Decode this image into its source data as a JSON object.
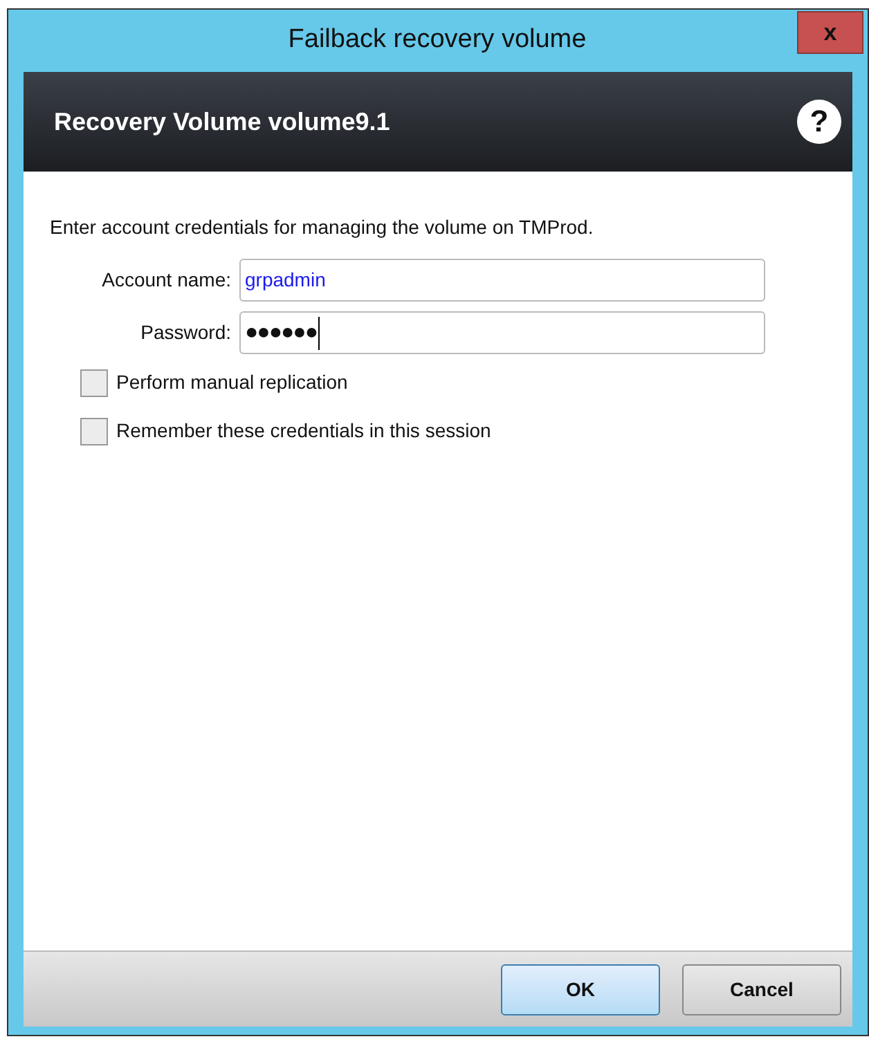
{
  "window": {
    "title": "Failback recovery volume",
    "close": "x"
  },
  "header": {
    "title": "Recovery Volume volume9.1",
    "help": "?"
  },
  "instructions": "Enter account credentials for managing the volume on TMProd.",
  "fields": [
    {
      "label": "Account name:",
      "value": "grpadmin",
      "kind": "text"
    },
    {
      "label": "Password:",
      "value": "●●●●●●",
      "kind": "password"
    }
  ],
  "options": [
    {
      "label": "Perform manual replication",
      "checked": false
    },
    {
      "label": "Remember these credentials in this session",
      "checked": false
    }
  ],
  "buttons": [
    {
      "label": "OK",
      "default": true
    },
    {
      "label": "Cancel",
      "default": false
    }
  ]
}
